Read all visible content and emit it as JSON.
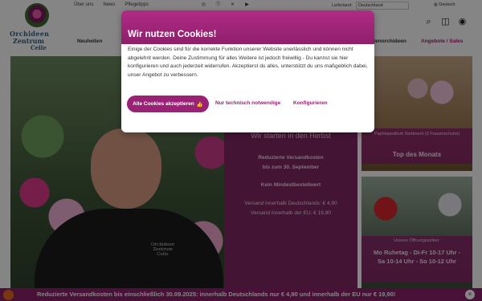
{
  "topbar": {
    "links": [
      "Über uns",
      "News",
      "Pflegetipps"
    ],
    "country_label": "Lieferland:",
    "country_value": "Deutschland",
    "language": "Deutsch"
  },
  "logo": {
    "line1": "Orchideen",
    "line2": "Zentrum",
    "line3": "Celle"
  },
  "nav": {
    "item_first": "Neuheiten",
    "item_partial": "tenorchideen",
    "item_sale": "Angebote / Sales"
  },
  "hero": {
    "shirt_text_1": "Orchideen",
    "shirt_text_2": "Zentrum",
    "shirt_text_3": "Celle",
    "headline": "Wir starten in den Herbst",
    "reduced_1": "Reduzierte Versandkosten",
    "reduced_2": "bis zum 30. September",
    "min_order": "Kein Mindestbestellwert",
    "ship_de": "Versand innerhalb Deutschlands: € 4,90",
    "ship_eu": "Versand innerhalb der EU: € 19,90"
  },
  "side1": {
    "small": "Paphiopedilum Sortiment (3 Frauenschuhe)",
    "title": "Top des Monats"
  },
  "side2": {
    "small": "Unsere Öffnungszeiten:",
    "line1": "Mo Ruhetag - Di-Fr 10-17 Uhr -",
    "line2": "Sa 10-14 Uhr - So 10-12 Uhr"
  },
  "ticker": {
    "text": "Reduzierte Versandkosten bis einschließlich 30.09.2025: innerhalb Deutschlands nur € 4,90 und innerhalb der EU nur € 19,90!"
  },
  "cookie_modal": {
    "title": "Wir nutzen Cookies!",
    "body": "Einige der Cookies sind für die korrekte Funktion unserer Website unerlässlich und können nicht abgelehnt werden. Deine Zustimmung für alles Weitere ist jedoch freiwillig - Du kannst sie hier konfigurieren und auch jederzeit widerrufen. Akzeptierst du alles, unterstützt du uns maßgeblich dabei, unser Angebot zu verbessern.",
    "accept_label": "Alle Cookies akzeptieren",
    "necessary_label": "Nur technisch notwendige",
    "configure_label": "Konfigurieren"
  },
  "icons": {
    "social": [
      "instagram-icon",
      "facebook-icon",
      "x-icon",
      "youtube-icon"
    ],
    "header": [
      "search-icon",
      "cart-icon",
      "account-icon"
    ]
  },
  "colors": {
    "brand": "#8e1f6b",
    "brand_light": "#b12b86",
    "overlay_panel": "#8e236e"
  }
}
